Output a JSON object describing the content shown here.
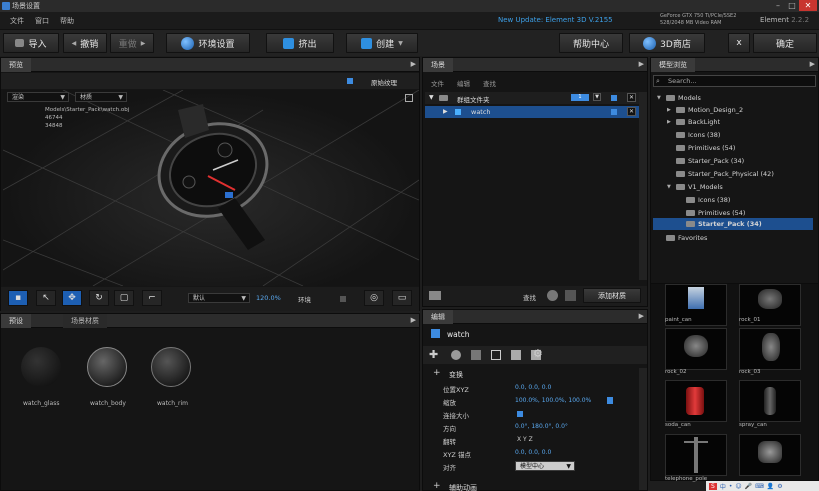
{
  "window": {
    "title": "场景设置"
  },
  "menu": {
    "items": [
      "文件",
      "窗口",
      "帮助"
    ],
    "update": "New Update: Element 3D V.2155",
    "gpu_line1": "GeForce GTX 750 Ti/PCIe/SSE2",
    "gpu_line2": "528/2048 MB Video RAM",
    "app_name": "Element",
    "app_version": "2.2.2"
  },
  "toolbar": {
    "import": "导入",
    "undo": "撤销",
    "redo": "重做",
    "environment": "环境设置",
    "extrude": "挤出",
    "create": "创建",
    "help": "帮助中心",
    "store": "3D商店",
    "close": "x",
    "ok": "确定"
  },
  "preview": {
    "tab": "预览",
    "group_label": "原始纹理",
    "shading": "渲染",
    "material": "材质",
    "file_path": "Models\\Starter_Pack\\watch.obj",
    "stat1": "46744",
    "stat2": "34848",
    "zoom_mode": "默认",
    "zoom_value": "120.0%",
    "env_label": "环境"
  },
  "presets": {
    "tab_presets": "预设",
    "tab_scene_materials": "场景材质",
    "items": [
      "watch_glass",
      "watch_body",
      "watch_rim"
    ]
  },
  "scene": {
    "tab": "场景",
    "menu": [
      "文件",
      "编辑",
      "查找"
    ],
    "group_name": "群组文件夹",
    "group_badge": "1",
    "item_name": "watch",
    "search_label": "查找",
    "add_material": "添加材质"
  },
  "edit": {
    "tab": "编辑",
    "object": "watch",
    "section_transform": "变换",
    "rows": [
      {
        "label": "位置XYZ",
        "value": "0.0, 0.0, 0.0"
      },
      {
        "label": "缩放",
        "value": "100.0%, 100.0%, 100.0%"
      },
      {
        "label": "连接大小",
        "value": ""
      },
      {
        "label": "方向",
        "value": "0.0°, 180.0°, 0.0°"
      },
      {
        "label": "翻转",
        "value": "X    Y    Z"
      },
      {
        "label": "XYZ 锚点",
        "value": "0.0, 0.0, 0.0"
      },
      {
        "label": "对齐",
        "value": "模型中心"
      }
    ],
    "section_aux": "辅助动画"
  },
  "browser": {
    "tab": "模型浏览",
    "search_placeholder": "Search...",
    "tree": [
      {
        "label": "Models",
        "level": 0,
        "arrow": "▼"
      },
      {
        "label": "Motion_Design_2",
        "level": 1,
        "arrow": "▶"
      },
      {
        "label": "BackLight",
        "level": 1,
        "arrow": "▶"
      },
      {
        "label": "Icons (38)",
        "level": 1,
        "arrow": ""
      },
      {
        "label": "Primitives (54)",
        "level": 1,
        "arrow": ""
      },
      {
        "label": "Starter_Pack (34)",
        "level": 1,
        "arrow": ""
      },
      {
        "label": "Starter_Pack_Physical (42)",
        "level": 1,
        "arrow": ""
      },
      {
        "label": "V1_Models",
        "level": 1,
        "arrow": "▼"
      },
      {
        "label": "Icons (38)",
        "level": 2,
        "arrow": ""
      },
      {
        "label": "Primitives (54)",
        "level": 2,
        "arrow": ""
      },
      {
        "label": "Starter_Pack (34)",
        "level": 2,
        "arrow": ""
      },
      {
        "label": "Favorites",
        "level": 0,
        "arrow": ""
      }
    ],
    "thumbs": [
      "paint_can",
      "rock_01",
      "rock_02",
      "rock_03",
      "soda_can",
      "spray_can",
      "telephone_pole",
      ""
    ]
  },
  "tray": {
    "icons": [
      "S",
      "中",
      "•",
      "☺",
      "🎤",
      "⌨",
      "👤",
      "⚙"
    ]
  }
}
